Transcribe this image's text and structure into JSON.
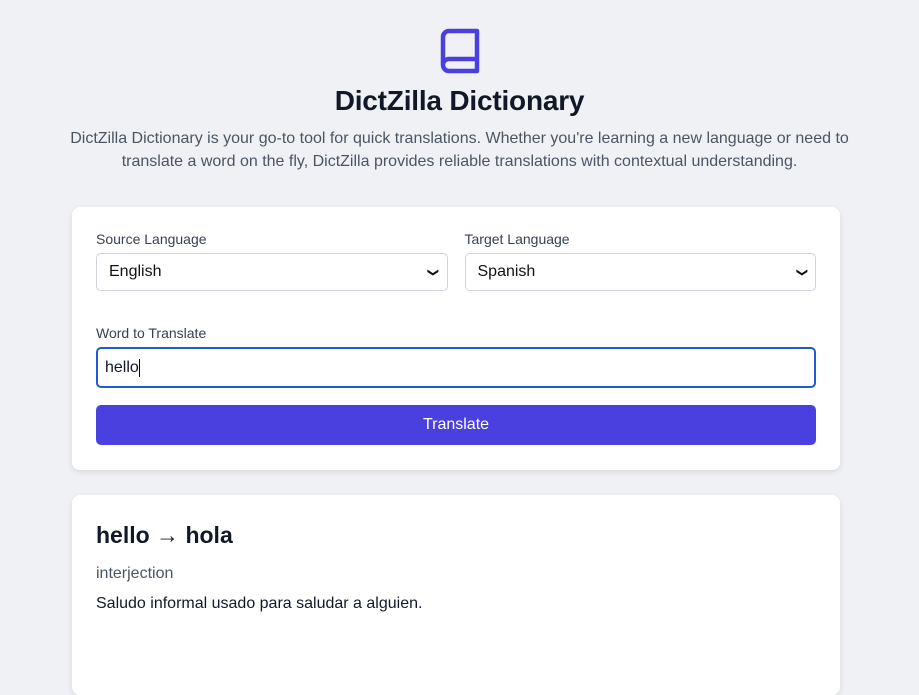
{
  "header": {
    "logo_icon": "book-icon",
    "title": "DictZilla Dictionary",
    "description": "DictZilla Dictionary is your go-to tool for quick translations. Whether you're learning a new language or need to translate a word on the fly, DictZilla provides reliable translations with contextual understanding."
  },
  "form": {
    "source_label": "Source Language",
    "source_value": "English",
    "target_label": "Target Language",
    "target_value": "Spanish",
    "word_label": "Word to Translate",
    "word_value": "hello",
    "translate_label": "Translate"
  },
  "result": {
    "heading": "hello → hola",
    "part_of_speech": "interjection",
    "definition": "Saludo informal usado para saludar a alguien."
  },
  "colors": {
    "accent": "#4a3fdf",
    "focus_border": "#1e5bd6"
  }
}
